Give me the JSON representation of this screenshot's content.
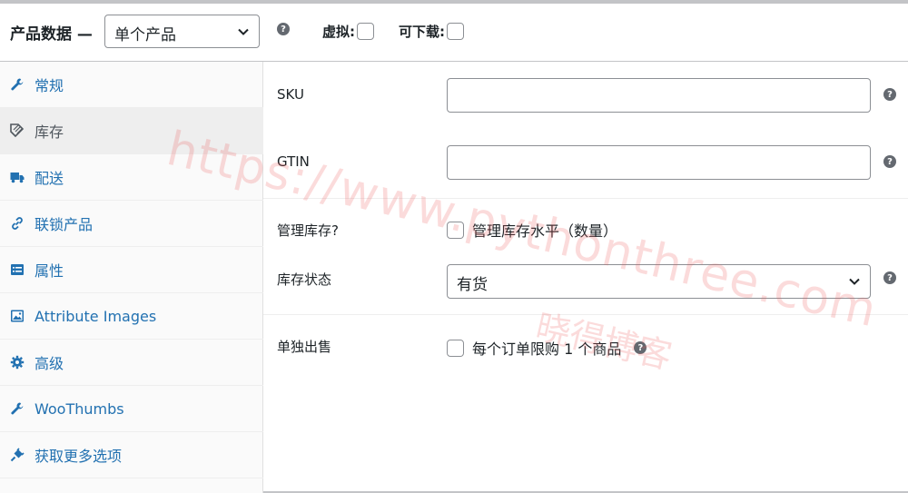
{
  "header": {
    "title": "产品数据 —",
    "product_type": "单个产品",
    "virtual_label": "虚拟:",
    "downloadable_label": "可下载:"
  },
  "sidebar": {
    "items": [
      {
        "label": "常规",
        "icon": "wrench-icon"
      },
      {
        "label": "库存",
        "icon": "tag-icon"
      },
      {
        "label": "配送",
        "icon": "truck-icon"
      },
      {
        "label": "联锁产品",
        "icon": "link-icon"
      },
      {
        "label": "属性",
        "icon": "list-icon"
      },
      {
        "label": "Attribute Images",
        "icon": "image-icon"
      },
      {
        "label": "高级",
        "icon": "gear-icon"
      },
      {
        "label": "WooThumbs",
        "icon": "wrench-icon"
      },
      {
        "label": "获取更多选项",
        "icon": "plugin-icon"
      }
    ]
  },
  "inventory": {
    "sku_label": "SKU",
    "sku_value": "",
    "gtin_label": "GTIN",
    "gtin_value": "",
    "manage_stock_label": "管理库存?",
    "manage_stock_checkbox_label": "管理库存水平（数量）",
    "stock_status_label": "库存状态",
    "stock_status_value": "有货",
    "sold_individually_label": "单独出售",
    "sold_individually_checkbox_label": "每个订单限购 1 个商品"
  },
  "watermark": {
    "url": "https://www.pythonthree.com",
    "name": "晓得博客"
  },
  "colors": {
    "link": "#2271b1",
    "active_tab_bg": "#eeeeee",
    "border": "#8c8f94"
  }
}
